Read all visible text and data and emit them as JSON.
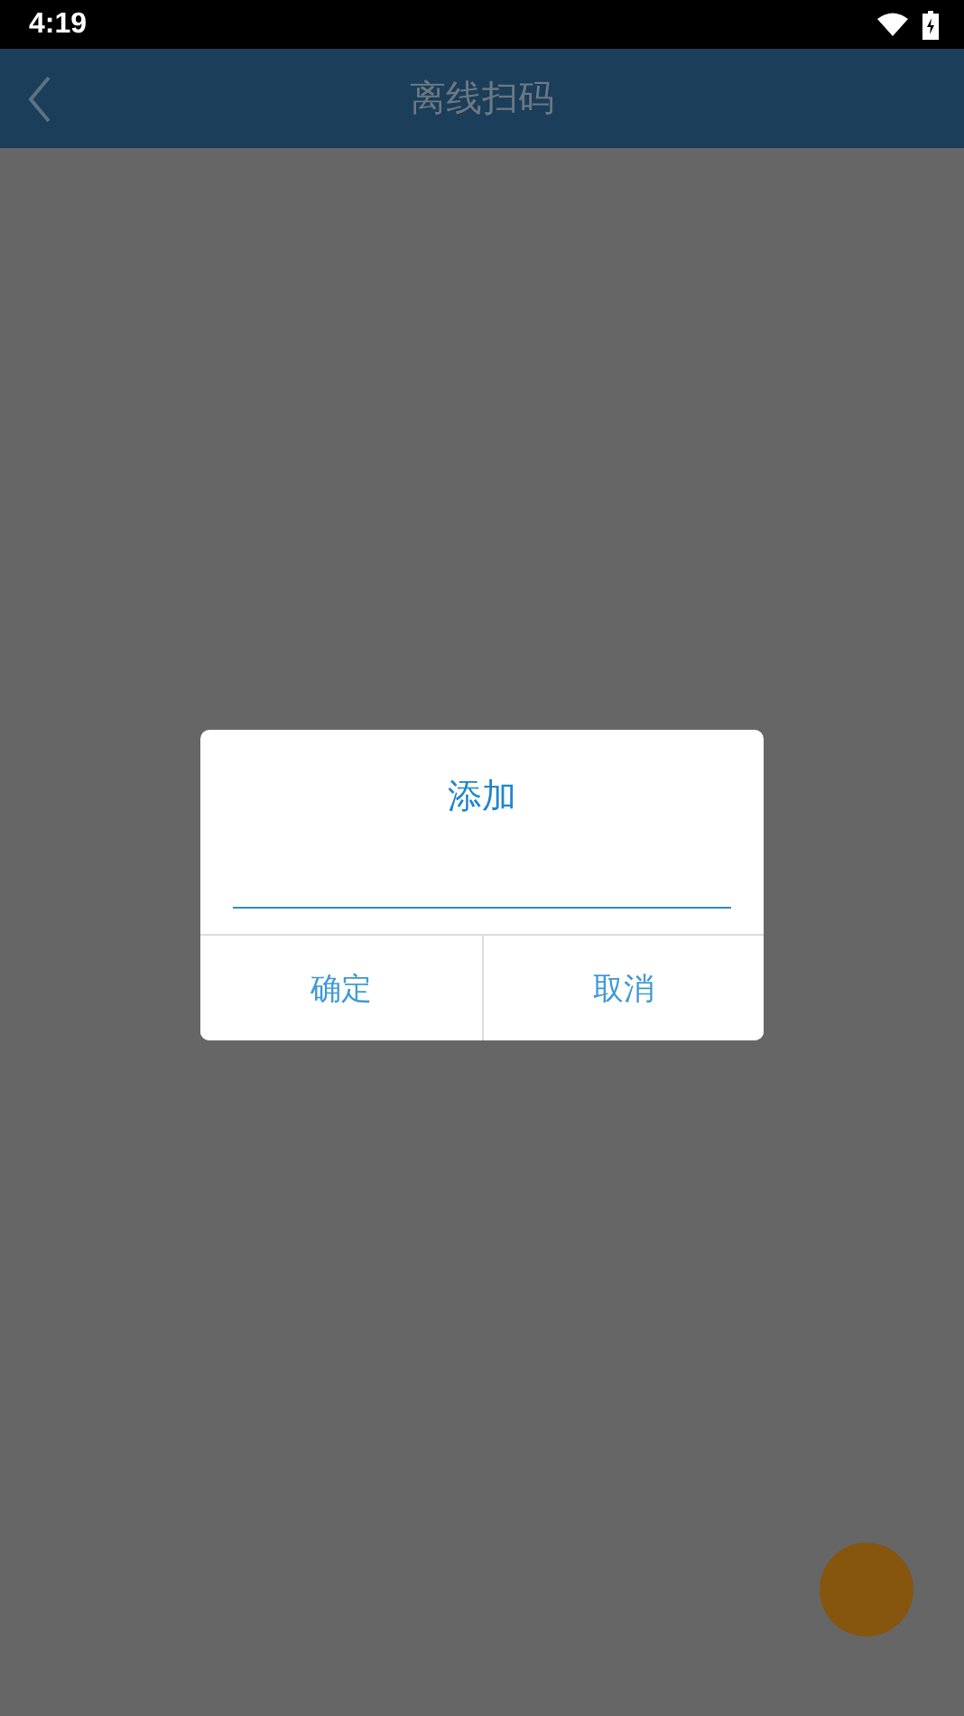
{
  "status_bar": {
    "time": "4:19"
  },
  "app_bar": {
    "title": "离线扫码"
  },
  "dialog": {
    "title": "添加",
    "buttons": [
      "确定",
      "取消"
    ]
  }
}
